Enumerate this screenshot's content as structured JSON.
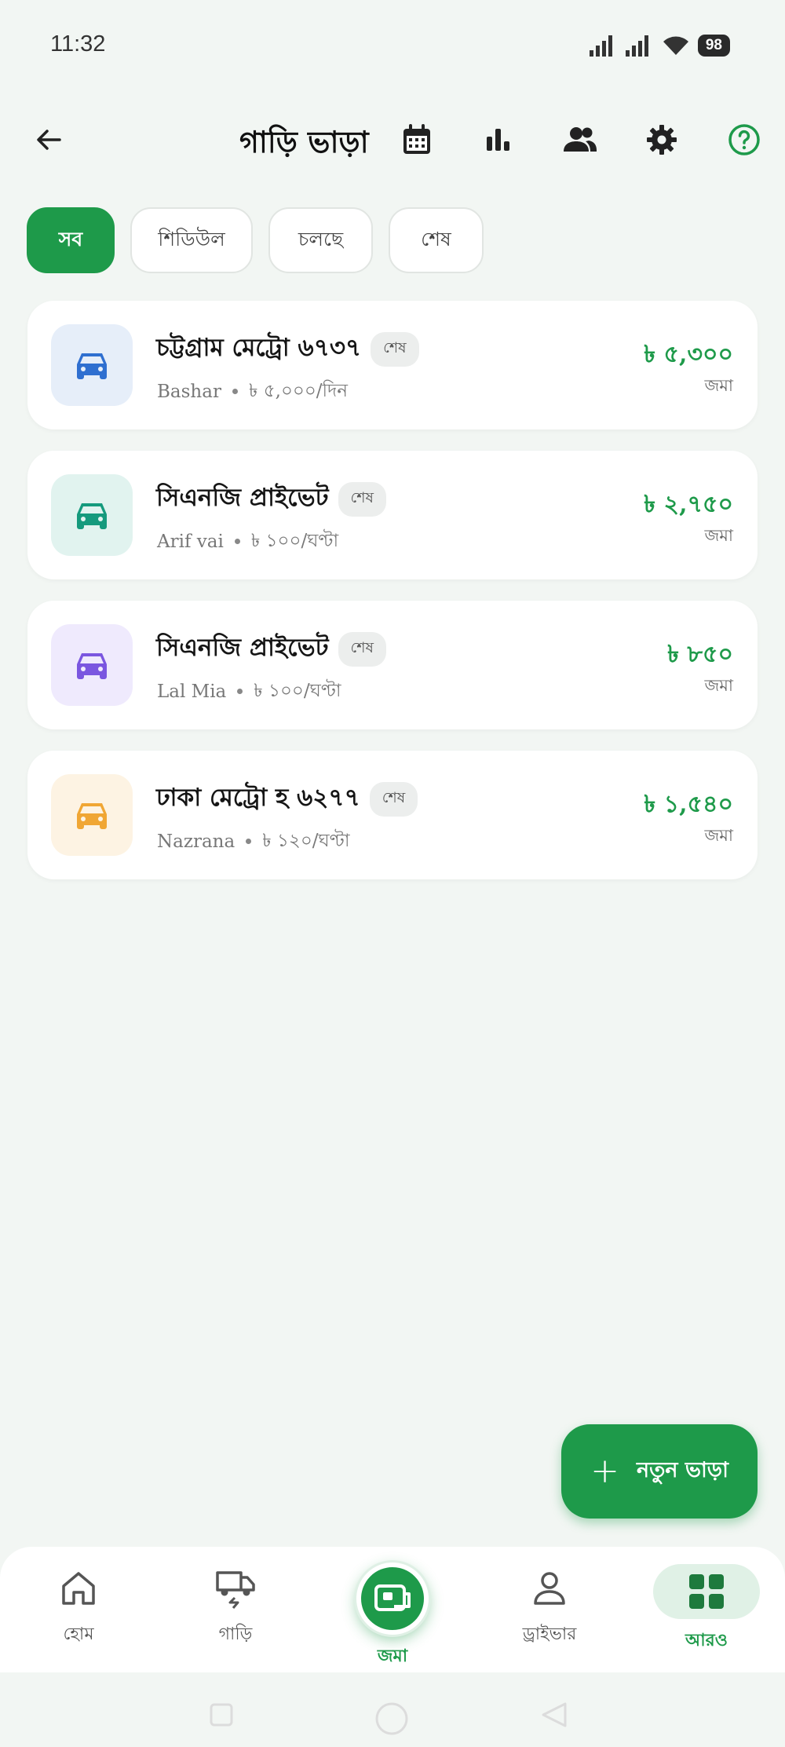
{
  "status_bar": {
    "time": "11:32",
    "battery": "98"
  },
  "header": {
    "title": "গাড়ি ভাড়া"
  },
  "filters": [
    {
      "label": "সব",
      "active": true
    },
    {
      "label": "শিডিউল",
      "active": false
    },
    {
      "label": "চলছে",
      "active": false
    },
    {
      "label": "শেষ",
      "active": false
    }
  ],
  "rentals": [
    {
      "name": "চট্টগ্রাম মেট্রো ৬৭৩৭",
      "status": "শেষ",
      "driver": "Bashar",
      "rate": "৳ ৫,০০০/দিন",
      "amount": "৳ ৫,৩০০",
      "amount_label": "জমা",
      "color": "#2f6fd0",
      "bg": "#e6eef9"
    },
    {
      "name": "সিএনজি প্রাইভেট",
      "status": "শেষ",
      "driver": "Arif vai",
      "rate": "৳ ১০০/ঘণ্টা",
      "amount": "৳ ২,৭৫০",
      "amount_label": "জমা",
      "color": "#159a7d",
      "bg": "#e1f3ef"
    },
    {
      "name": "সিএনজি প্রাইভেট",
      "status": "শেষ",
      "driver": "Lal Mia",
      "rate": "৳ ১০০/ঘণ্টা",
      "amount": "৳ ৮৫০",
      "amount_label": "জমা",
      "color": "#7a56e0",
      "bg": "#efeafd"
    },
    {
      "name": "ঢাকা মেট্রো হ ৬২৭৭",
      "status": "শেষ",
      "driver": "Nazrana",
      "rate": "৳ ১২০/ঘণ্টা",
      "amount": "৳ ১,৫৪০",
      "amount_label": "জমা",
      "color": "#f0a634",
      "bg": "#fdf3e3"
    }
  ],
  "fab": {
    "label": "নতুন ভাড়া"
  },
  "bottom_nav": [
    {
      "label": "হোম",
      "icon": "home-icon"
    },
    {
      "label": "গাড়ি",
      "icon": "vehicle-icon"
    },
    {
      "label": "জমা",
      "icon": "wallet-icon"
    },
    {
      "label": "ড্রাইভার",
      "icon": "person-icon"
    },
    {
      "label": "আরও",
      "icon": "grid-icon"
    }
  ],
  "colors": {
    "accent": "#1e9a4a",
    "background": "#f2f6f3"
  }
}
